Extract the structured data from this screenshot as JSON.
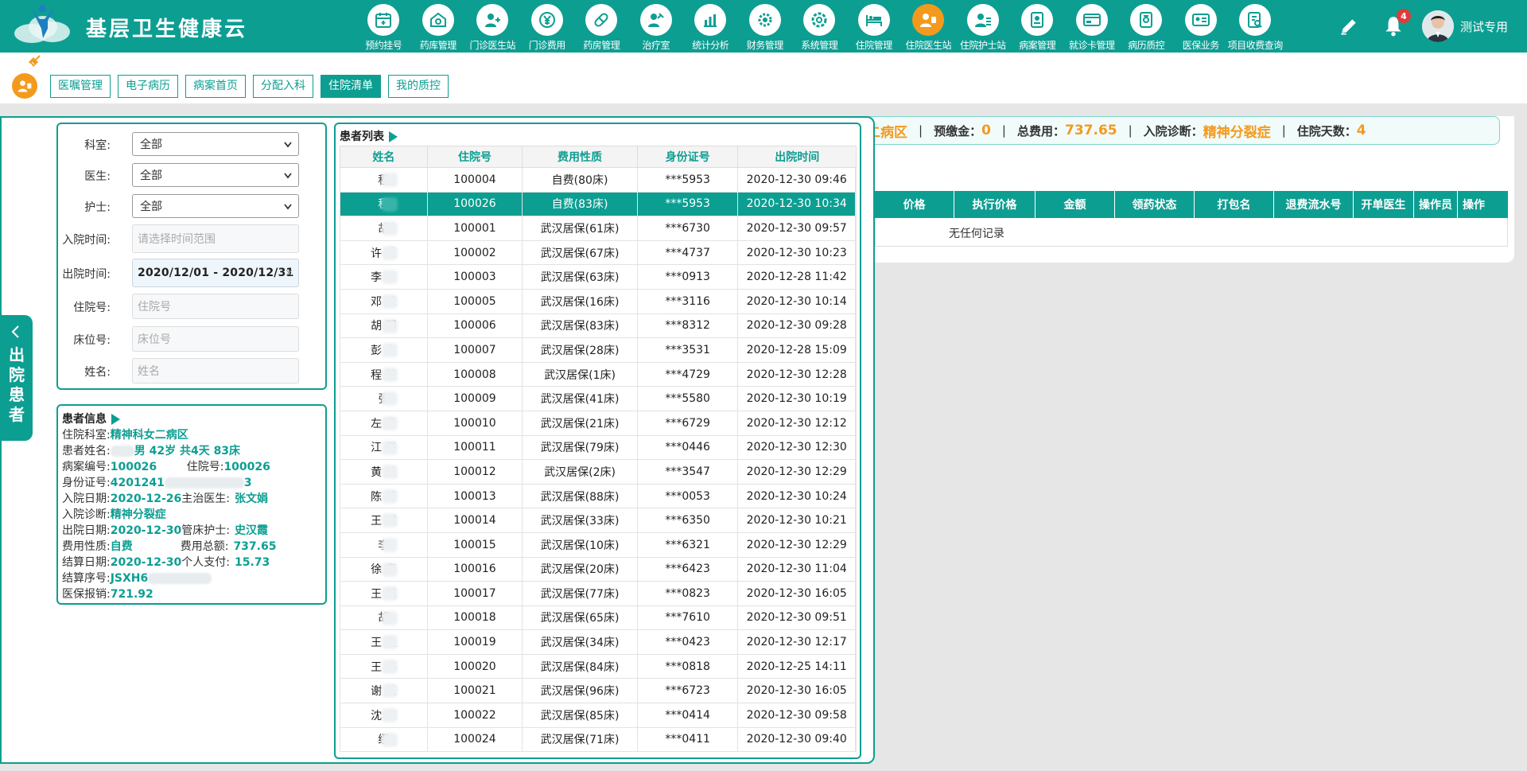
{
  "header": {
    "app_title": "基层卫生健康云",
    "nav": [
      {
        "label": "预约挂号",
        "icon": "calendar-icon"
      },
      {
        "label": "药库管理",
        "icon": "warehouse-icon"
      },
      {
        "label": "门诊医生站",
        "icon": "doctor-icon"
      },
      {
        "label": "门诊费用",
        "icon": "yuan-icon"
      },
      {
        "label": "药房管理",
        "icon": "pill-icon"
      },
      {
        "label": "治疗室",
        "icon": "treatment-icon"
      },
      {
        "label": "统计分析",
        "icon": "chart-icon"
      },
      {
        "label": "财务管理",
        "icon": "finance-gear-icon"
      },
      {
        "label": "系统管理",
        "icon": "settings-icon"
      },
      {
        "label": "住院管理",
        "icon": "bed-icon"
      },
      {
        "label": "住院医生站",
        "icon": "inpatient-doctor-icon",
        "active": true
      },
      {
        "label": "住院护士站",
        "icon": "nurse-icon"
      },
      {
        "label": "病案管理",
        "icon": "record-icon"
      },
      {
        "label": "就诊卡管理",
        "icon": "card-icon"
      },
      {
        "label": "病历质控",
        "icon": "quality-icon"
      },
      {
        "label": "医保业务",
        "icon": "insurance-icon"
      },
      {
        "label": "项目收费查询",
        "icon": "fee-query-icon"
      }
    ],
    "notification_count": "4",
    "username": "测试专用"
  },
  "tabs": [
    {
      "label": "医嘱管理",
      "active": false
    },
    {
      "label": "电子病历",
      "active": false
    },
    {
      "label": "病案首页",
      "active": false
    },
    {
      "label": "分配入科",
      "active": false
    },
    {
      "label": "住院清单",
      "active": true
    },
    {
      "label": "我的质控",
      "active": false
    }
  ],
  "summary_bar": {
    "ward_fragment": "二病区",
    "deposit_label": "预缴金：",
    "deposit_value": "0",
    "total_label": "总费用：",
    "total_value": "737.65",
    "diagnosis_label": "入院诊断：",
    "diagnosis_value": "精神分裂症",
    "days_label": "住院天数：",
    "days_value": "4"
  },
  "detail_table": {
    "columns": [
      "价格",
      "执行价格",
      "金额",
      "领药状态",
      "打包名",
      "退费流水号",
      "开单医生",
      "操作员",
      "操作"
    ],
    "empty_text": "无任何记录"
  },
  "drawer": {
    "handle_label": "出院患者"
  },
  "filters": {
    "dept_label": "科室:",
    "dept_value": "全部",
    "doctor_label": "医生:",
    "doctor_value": "全部",
    "nurse_label": "护士:",
    "nurse_value": "全部",
    "admit_label": "入院时间:",
    "admit_placeholder": "请选择时间范围",
    "discharge_label": "出院时间:",
    "discharge_value": "2020/12/01 - 2020/12/31",
    "inpatient_no_label": "住院号:",
    "inpatient_no_placeholder": "住院号",
    "bed_label": "床位号:",
    "bed_placeholder": "床位号",
    "name_label": "姓名:",
    "name_placeholder": "姓名"
  },
  "patient_info": {
    "title": "患者信息",
    "dept_label": "住院科室:",
    "dept_value": "精神科女二病区",
    "name_label": "患者姓名:",
    "name_value": "男 42岁 共4天 83床",
    "case_no_label": "病案编号:",
    "case_no_value": "100026",
    "inpatient_no_label": "住院号:",
    "inpatient_no_value": "100026",
    "id_label": "身份证号:",
    "id_value": "4201241",
    "id_tail": "3",
    "admit_date_label": "入院日期:",
    "admit_date_value": "2020-12-26",
    "attending_label": "主治医生:",
    "attending_value": "张文娟",
    "diagnosis_label": "入院诊断:",
    "diagnosis_value": "精神分裂症",
    "discharge_date_label": "出院日期:",
    "discharge_date_value": "2020-12-30",
    "nurse_label": "管床护士:",
    "nurse_value": "史汉霞",
    "fee_type_label": "费用性质:",
    "fee_type_value": "自费",
    "fee_total_label": "费用总额:",
    "fee_total_value": "737.65",
    "settle_date_label": "结算日期:",
    "settle_date_value": "2020-12-30",
    "self_pay_label": "个人支付:",
    "self_pay_value": "15.73",
    "settle_no_label": "结算序号:",
    "settle_no_value": "JSXH6",
    "reimb_label": "医保报销:",
    "reimb_value": "721.92"
  },
  "patient_list": {
    "title": "患者列表",
    "columns": [
      "姓名",
      "住院号",
      "费用性质",
      "身份证号",
      "出院时间"
    ],
    "rows": [
      {
        "name": "程",
        "no": "100004",
        "fee": "自费(80床)",
        "id": "***5953",
        "time": "2020-12-30 09:46"
      },
      {
        "name": "程",
        "no": "100026",
        "fee": "自费(83床)",
        "id": "***5953",
        "time": "2020-12-30 10:34",
        "selected": true
      },
      {
        "name": "胡",
        "no": "100001",
        "fee": "武汉居保(61床)",
        "id": "***6730",
        "time": "2020-12-30 09:57"
      },
      {
        "name": "许  兵",
        "no": "100002",
        "fee": "武汉居保(67床)",
        "id": "***4737",
        "time": "2020-12-30 10:23"
      },
      {
        "name": "李  平",
        "no": "100003",
        "fee": "武汉居保(63床)",
        "id": "***0913",
        "time": "2020-12-28 11:42"
      },
      {
        "name": "邓  球",
        "no": "100005",
        "fee": "武汉居保(16床)",
        "id": "***3116",
        "time": "2020-12-30 10:14"
      },
      {
        "name": "胡  明",
        "no": "100006",
        "fee": "武汉居保(83床)",
        "id": "***8312",
        "time": "2020-12-30 09:28"
      },
      {
        "name": "彭  杰",
        "no": "100007",
        "fee": "武汉居保(28床)",
        "id": "***3531",
        "time": "2020-12-28 15:09"
      },
      {
        "name": "程  莲",
        "no": "100008",
        "fee": "武汉居保(1床)",
        "id": "***4729",
        "time": "2020-12-30 12:28"
      },
      {
        "name": "张",
        "no": "100009",
        "fee": "武汉居保(41床)",
        "id": "***5580",
        "time": "2020-12-30 10:19"
      },
      {
        "name": "左  青",
        "no": "100010",
        "fee": "武汉居保(21床)",
        "id": "***6729",
        "time": "2020-12-30 12:12"
      },
      {
        "name": "江  平",
        "no": "100011",
        "fee": "武汉居保(79床)",
        "id": "***0446",
        "time": "2020-12-30 12:30"
      },
      {
        "name": "黄  敏",
        "no": "100012",
        "fee": "武汉居保(2床)",
        "id": "***3547",
        "time": "2020-12-30 12:29"
      },
      {
        "name": "陈  芳",
        "no": "100013",
        "fee": "武汉居保(88床)",
        "id": "***0053",
        "time": "2020-12-30 10:24"
      },
      {
        "name": "王  斌",
        "no": "100014",
        "fee": "武汉居保(33床)",
        "id": "***6350",
        "time": "2020-12-30 10:21"
      },
      {
        "name": "李",
        "no": "100015",
        "fee": "武汉居保(10床)",
        "id": "***6321",
        "time": "2020-12-30 12:29"
      },
      {
        "name": "徐  春",
        "no": "100016",
        "fee": "武汉居保(20床)",
        "id": "***6423",
        "time": "2020-12-30 11:04"
      },
      {
        "name": "王  娟",
        "no": "100017",
        "fee": "武汉居保(77床)",
        "id": "***0823",
        "time": "2020-12-30 16:05"
      },
      {
        "name": "胡",
        "no": "100018",
        "fee": "武汉居保(65床)",
        "id": "***7610",
        "time": "2020-12-30 09:51"
      },
      {
        "name": "王  连",
        "no": "100019",
        "fee": "武汉居保(34床)",
        "id": "***0423",
        "time": "2020-12-30 12:17"
      },
      {
        "name": "王  伟",
        "no": "100020",
        "fee": "武汉居保(84床)",
        "id": "***0818",
        "time": "2020-12-25 14:11"
      },
      {
        "name": "谢  花",
        "no": "100021",
        "fee": "武汉居保(96床)",
        "id": "***6723",
        "time": "2020-12-30 16:05"
      },
      {
        "name": "沈  涛",
        "no": "100022",
        "fee": "武汉居保(85床)",
        "id": "***0414",
        "time": "2020-12-30 09:58"
      },
      {
        "name": "缪",
        "no": "100024",
        "fee": "武汉居保(71床)",
        "id": "***0411",
        "time": "2020-12-30 09:40"
      }
    ]
  },
  "colors": {
    "primary": "#0d9e92",
    "accent": "#f39a1e",
    "badge": "#e23a3a"
  }
}
